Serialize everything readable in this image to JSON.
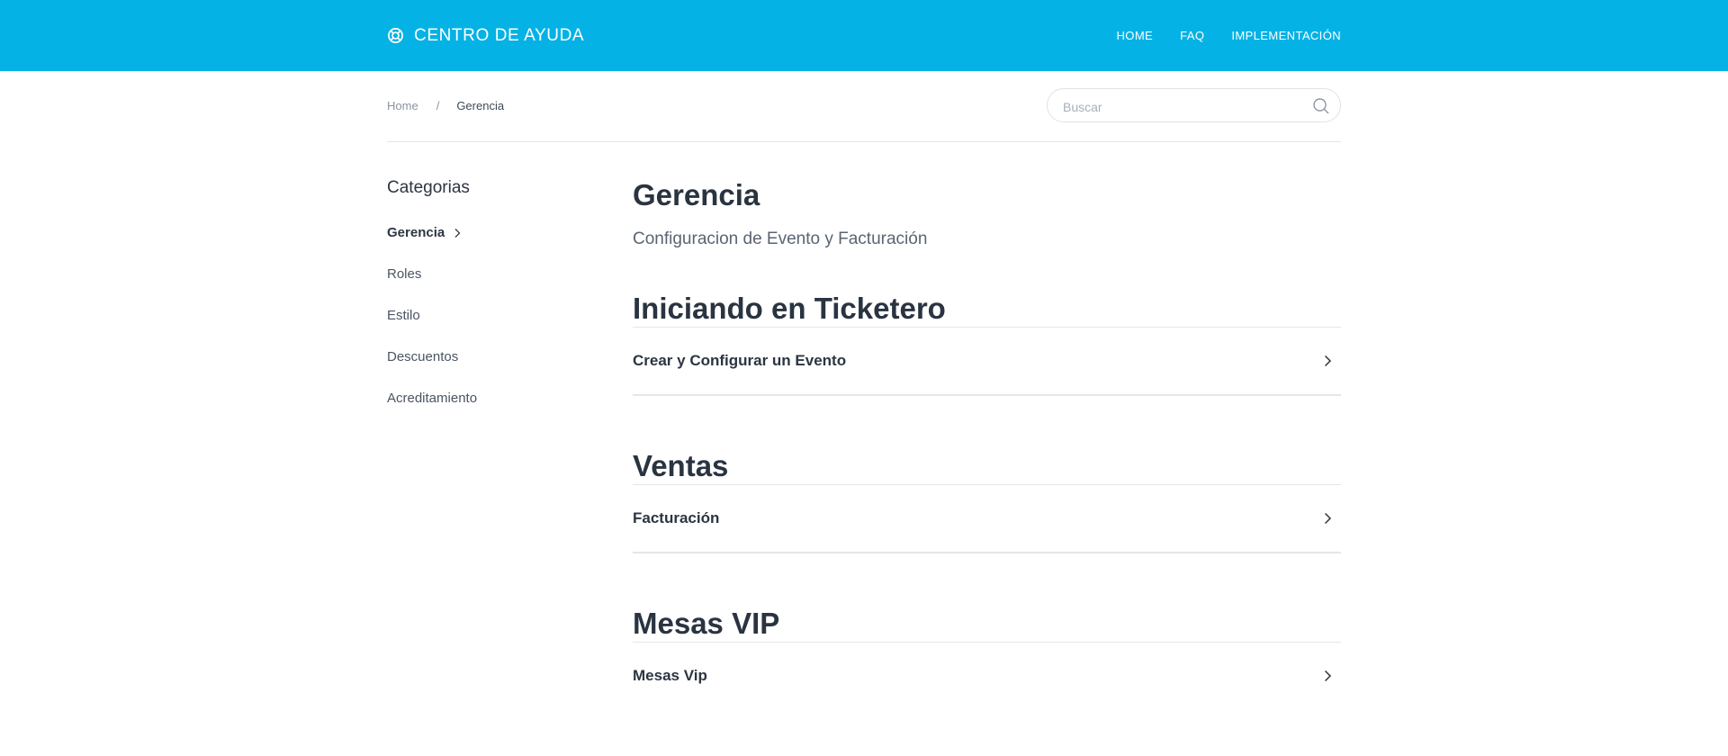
{
  "header": {
    "brand_icon": "lifebuoy-icon",
    "brand_title": "CENTRO DE AYUDA",
    "nav": [
      "HOME",
      "FAQ",
      "IMPLEMENTACIÓN"
    ]
  },
  "breadcrumb": {
    "home": "Home",
    "separator": "/",
    "current": "Gerencia"
  },
  "search": {
    "placeholder": "Buscar",
    "icon": "search-icon"
  },
  "sidebar": {
    "heading": "Categorias",
    "items": [
      {
        "label": "Gerencia",
        "active": true
      },
      {
        "label": "Roles"
      },
      {
        "label": "Estilo"
      },
      {
        "label": "Descuentos"
      },
      {
        "label": "Acreditamiento"
      }
    ]
  },
  "main": {
    "title": "Gerencia",
    "description": "Configuracion de Evento y Facturación",
    "sections": [
      {
        "title": "Iniciando en Ticketero",
        "articles": [
          "Crear y Configurar un Evento"
        ]
      },
      {
        "title": "Ventas",
        "articles": [
          "Facturación"
        ]
      },
      {
        "title": "Mesas VIP",
        "articles": [
          "Mesas Vip"
        ]
      }
    ]
  },
  "colors": {
    "header_bg": "#05b2e5",
    "text_dark": "#2c3542",
    "divider": "#e3e6ea"
  }
}
